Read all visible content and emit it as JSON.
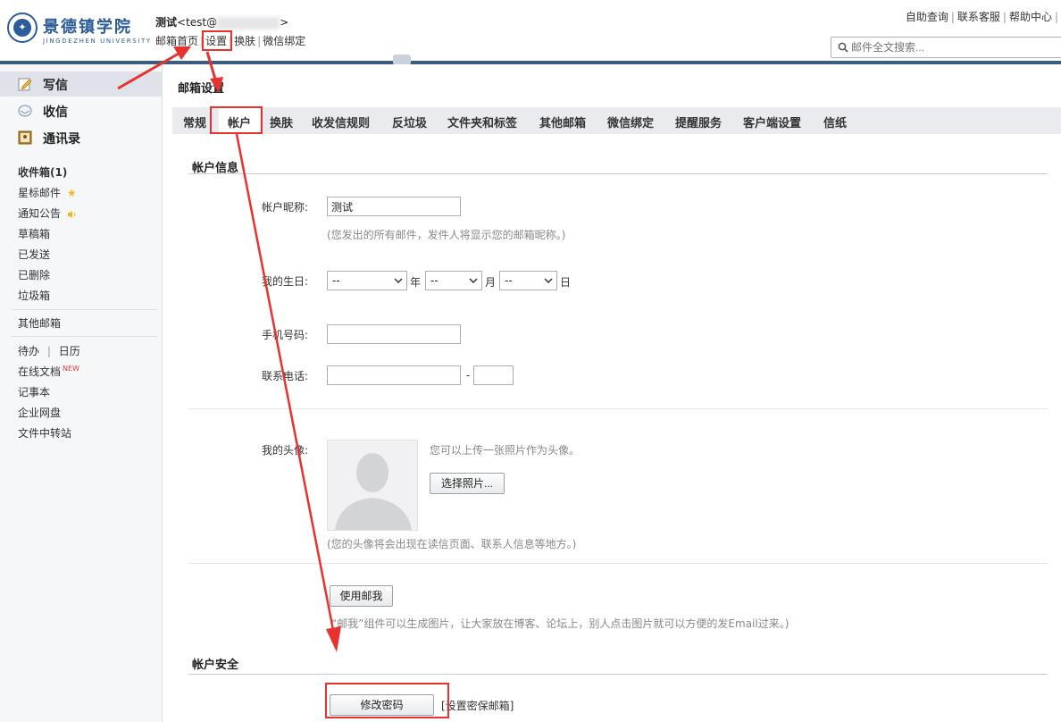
{
  "header": {
    "logo_cn": "景德镇学院",
    "logo_en": "JINGDEZHEN UNIVERSITY",
    "user_name": "测试",
    "user_email_start": "<test@",
    "user_email_end": ">",
    "nav": [
      "邮箱首页",
      "设置",
      "换肤",
      "微信绑定"
    ],
    "top_links": [
      "自助查询",
      "联系客服",
      "帮助中心"
    ],
    "search_placeholder": "邮件全文搜索..."
  },
  "sidebar": {
    "main_items": [
      {
        "label": "写信",
        "icon": "compose-icon"
      },
      {
        "label": "收信",
        "icon": "inbox-icon"
      },
      {
        "label": "通讯录",
        "icon": "contacts-icon"
      }
    ],
    "folders": [
      "收件箱(1)",
      "星标邮件",
      "通知公告",
      "草稿箱",
      "已发送",
      "已删除",
      "垃圾箱"
    ],
    "other_mail": "其他邮箱",
    "todo": "待办",
    "calendar": "日历",
    "online_docs": "在线文档",
    "new_badge": "NEW",
    "notes": "记事本",
    "netdisk": "企业网盘",
    "transfer": "文件中转站"
  },
  "main": {
    "page_title": "邮箱设置",
    "tabs": [
      "常规",
      "帐户",
      "换肤",
      "收发信规则",
      "反垃圾",
      "文件夹和标签",
      "其他邮箱",
      "微信绑定",
      "提醒服务",
      "客户端设置",
      "信纸"
    ],
    "account_info": {
      "title": "帐户信息",
      "nickname_label": "帐户昵称:",
      "nickname_value": "测试",
      "nickname_hint": "(您发出的所有邮件，发件人将显示您的邮箱昵称。)",
      "birthday_label": "我的生日:",
      "birthday_year": "--",
      "birthday_month": "--",
      "birthday_day": "--",
      "year_unit": "年",
      "month_unit": "月",
      "day_unit": "日",
      "mobile_label": "手机号码:",
      "phone_label": "联系电话:",
      "phone_sep": "-",
      "avatar_label": "我的头像:",
      "avatar_hint": "您可以上传一张照片作为头像。",
      "choose_photo": "选择照片...",
      "avatar_note": "(您的头像将会出现在读信页面、联系人信息等地方。)",
      "mail_me_button": "使用邮我",
      "mail_me_hint": "“邮我”组件可以生成图片，让大家放在博客、论坛上，别人点击图片就可以方便的发Email过来。)"
    },
    "account_security": {
      "title": "帐户安全",
      "change_password": "修改密码",
      "set_secure_mail": "[设置密保邮箱]"
    }
  },
  "colors": {
    "brand": "#2c5c99",
    "header_bar": "#3e5d7e",
    "annotation_red": "#e8322f"
  }
}
